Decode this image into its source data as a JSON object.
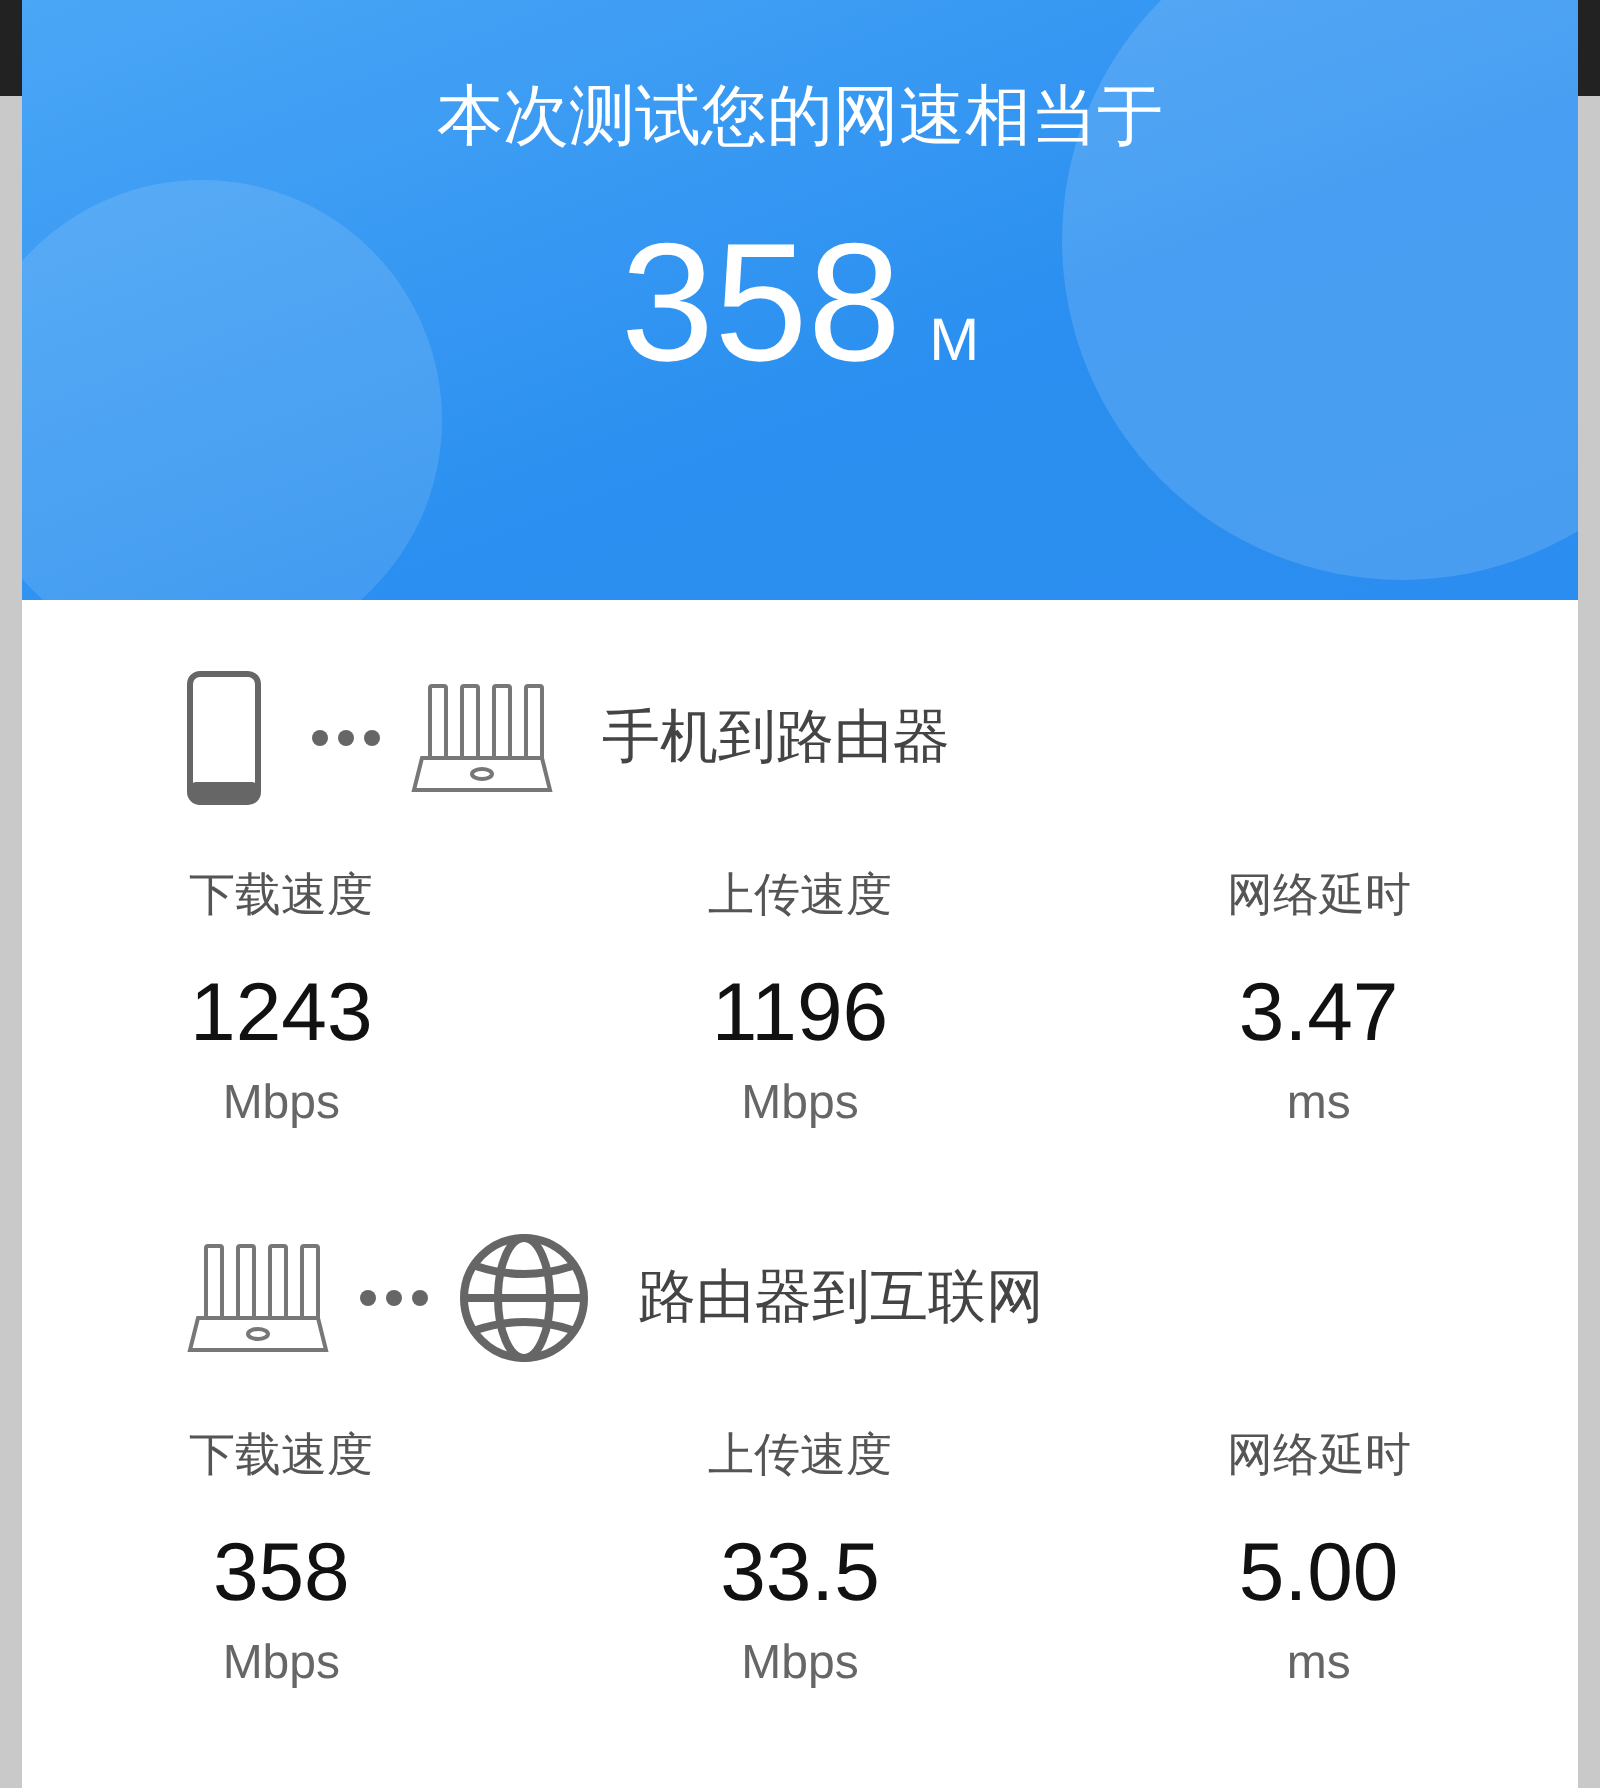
{
  "header": {
    "title": "本次测试您的网速相当于",
    "speed": "358",
    "unit": "M"
  },
  "sections": [
    {
      "kind": "phone-router",
      "title": "手机到路由器",
      "metrics": [
        {
          "label": "下载速度",
          "value": "1243",
          "unit": "Mbps"
        },
        {
          "label": "上传速度",
          "value": "1196",
          "unit": "Mbps"
        },
        {
          "label": "网络延时",
          "value": "3.47",
          "unit": "ms"
        }
      ]
    },
    {
      "kind": "router-internet",
      "title": "路由器到互联网",
      "metrics": [
        {
          "label": "下载速度",
          "value": "358",
          "unit": "Mbps"
        },
        {
          "label": "上传速度",
          "value": "33.5",
          "unit": "Mbps"
        },
        {
          "label": "网络延时",
          "value": "5.00",
          "unit": "ms"
        }
      ]
    }
  ]
}
